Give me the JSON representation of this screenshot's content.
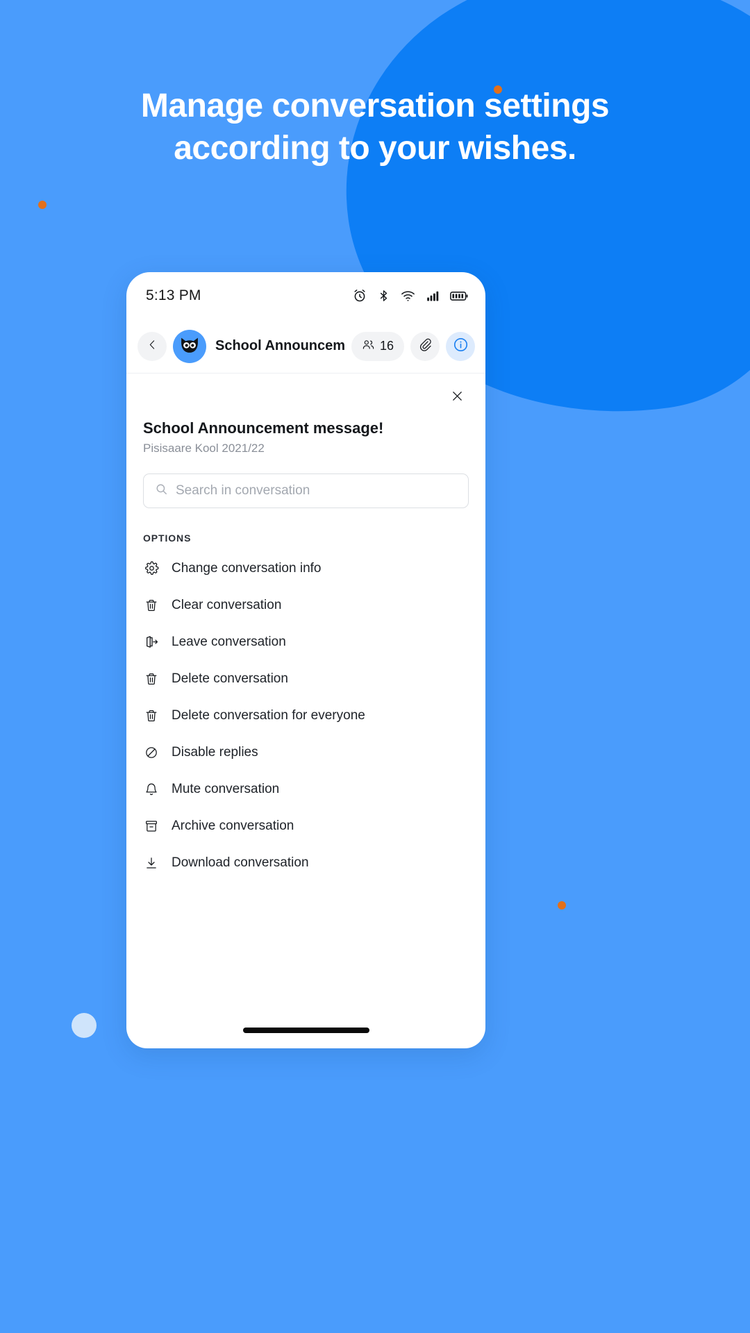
{
  "promo": {
    "headline": "Manage conversation settings according to your wishes.",
    "background_color": "#4A9CFC",
    "blob_color": "#0D7EF5",
    "accent_dot_color": "#E2701B",
    "pale_dot_color": "#CFE4FB"
  },
  "phone": {
    "statusbar": {
      "time": "5:13 PM",
      "icons": [
        "alarm-icon",
        "bluetooth-icon",
        "wifi-icon",
        "signal-icon",
        "battery-icon"
      ]
    },
    "conversation_header": {
      "back_icon": "chevron-left-icon",
      "avatar_icon": "owl-avatar",
      "title": "School Announcement...",
      "members_icon": "people-icon",
      "members_count": "16",
      "attachment_icon": "paperclip-icon",
      "info_icon": "info-icon",
      "info_active_color": "#1B7FF0"
    },
    "panel": {
      "close_icon": "close-icon",
      "title": "School Announcement message!",
      "subtitle": "Pisisaare Kool 2021/22",
      "search": {
        "icon": "search-icon",
        "placeholder": "Search in conversation",
        "value": ""
      },
      "section_label": "OPTIONS",
      "options": [
        {
          "icon": "gear-icon",
          "label": "Change conversation info"
        },
        {
          "icon": "trash-icon",
          "label": "Clear conversation"
        },
        {
          "icon": "leave-icon",
          "label": "Leave conversation"
        },
        {
          "icon": "trash-icon",
          "label": "Delete conversation"
        },
        {
          "icon": "trash-icon",
          "label": "Delete conversation for everyone"
        },
        {
          "icon": "block-icon",
          "label": "Disable replies"
        },
        {
          "icon": "bell-icon",
          "label": "Mute conversation"
        },
        {
          "icon": "archive-icon",
          "label": "Archive conversation"
        },
        {
          "icon": "download-icon",
          "label": "Download conversation"
        }
      ]
    },
    "home_indicator": "home-indicator"
  }
}
